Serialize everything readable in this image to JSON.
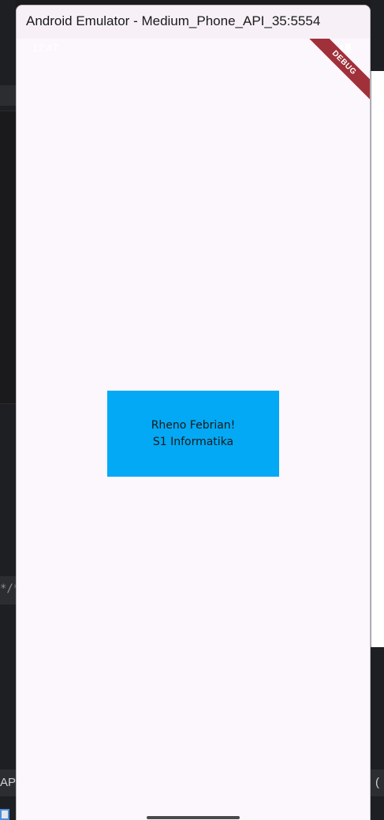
{
  "window": {
    "title": "Android Emulator - Medium_Phone_API_35:5554"
  },
  "status_bar": {
    "time": "12:47",
    "icons": [
      "wifi-icon",
      "signal-icon",
      "battery-icon"
    ]
  },
  "debug_banner": {
    "label": "DEBUG"
  },
  "content": {
    "line1": "Rheno Febrian!",
    "line2": "S1 Informatika",
    "box_color": "#03a9f4"
  },
  "background": {
    "left_code_fragment": "*/*",
    "left_bottom_fragment": "AP",
    "right_bottom_fragment": "("
  },
  "colors": {
    "screen_background": "#fcf6fd",
    "title_bar": "#f7f1f7",
    "debug_ribbon": "#a0303a"
  }
}
